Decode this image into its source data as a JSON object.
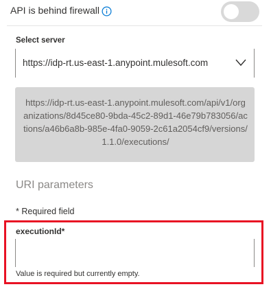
{
  "firewall": {
    "label": "API is behind firewall",
    "info_icon": "info-icon",
    "toggle_state": "off"
  },
  "server": {
    "label": "Select server",
    "selected": "https://idp-rt.us-east-1.anypoint.mulesoft.com",
    "chevron_icon": "chevron-down-icon"
  },
  "request_url": "https://idp-rt.us-east-1.anypoint.mulesoft.com/api/v1/organizations/8d45ce80-9bda-45c2-89d1-46e79b783056/actions/a46b6a8b-985e-4fa0-9059-2c61a2054cf9/versions/1.1.0/executions/",
  "uri_parameters": {
    "title": "URI parameters",
    "required_note": "* Required field",
    "execution_id": {
      "label": "executionId*",
      "value": "",
      "error": "Value is required but currently empty."
    }
  },
  "colors": {
    "highlight_border": "#e81123",
    "info_blue": "#0078d4",
    "toggle_off": "#d9d9d9"
  }
}
